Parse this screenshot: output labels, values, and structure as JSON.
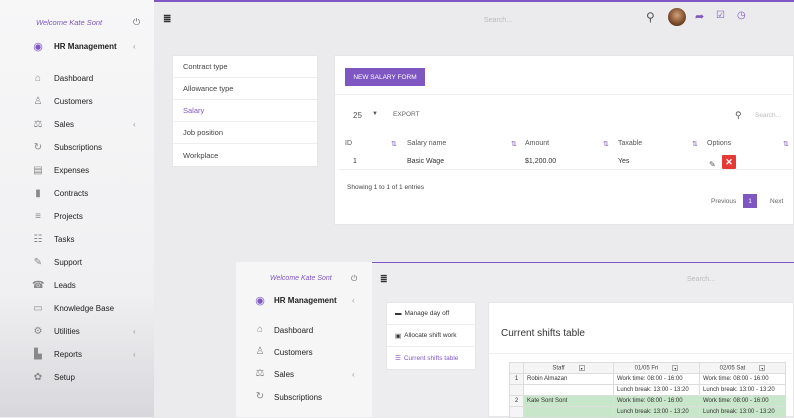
{
  "sidebar": {
    "welcome": "Welcome Kate Sont",
    "items": [
      {
        "label": "HR Management",
        "icon": "circle-user-icon",
        "caret": "‹"
      },
      {
        "label": "Dashboard",
        "icon": "home-icon",
        "caret": ""
      },
      {
        "label": "Customers",
        "icon": "user-icon",
        "caret": ""
      },
      {
        "label": "Sales",
        "icon": "balance-scale-icon",
        "caret": "‹"
      },
      {
        "label": "Subscriptions",
        "icon": "refresh-icon",
        "caret": ""
      },
      {
        "label": "Expenses",
        "icon": "file-text-icon",
        "caret": ""
      },
      {
        "label": "Contracts",
        "icon": "file-icon",
        "caret": ""
      },
      {
        "label": "Projects",
        "icon": "bars-icon",
        "caret": ""
      },
      {
        "label": "Tasks",
        "icon": "tasks-icon",
        "caret": ""
      },
      {
        "label": "Support",
        "icon": "ticket-icon",
        "caret": ""
      },
      {
        "label": "Leads",
        "icon": "tty-icon",
        "caret": ""
      },
      {
        "label": "Knowledge Base",
        "icon": "folder-open-icon",
        "caret": ""
      },
      {
        "label": "Utilities",
        "icon": "cogs-icon",
        "caret": "‹"
      },
      {
        "label": "Reports",
        "icon": "area-chart-icon",
        "caret": "‹"
      },
      {
        "label": "Setup",
        "icon": "gear-icon",
        "caret": ""
      }
    ]
  },
  "topbar": {
    "search_placeholder": "Search..."
  },
  "settings_menu": {
    "items": [
      "Contract type",
      "Allowance type",
      "Salary",
      "Job position",
      "Workplace"
    ],
    "active": "Salary"
  },
  "salary_panel": {
    "new_button": "NEW SALARY FORM",
    "page_size": "25",
    "export_label": "EXPORT",
    "search_placeholder": "Search...",
    "columns": [
      "ID",
      "Salary name",
      "Amount",
      "Taxable",
      "Options"
    ],
    "rows": [
      {
        "id": "1",
        "name": "Basic Wage",
        "amount": "$1,200.00",
        "taxable": "Yes"
      }
    ],
    "showing": "Showing 1 to 1 of 1 entries",
    "prev_label": "Previous",
    "page": "1",
    "next_label": "Next"
  },
  "shot2": {
    "welcome": "Welcome Kate Sont",
    "search_placeholder": "Search...",
    "nav": [
      {
        "label": "HR Management",
        "caret": "‹"
      },
      {
        "label": "Dashboard",
        "caret": ""
      },
      {
        "label": "Customers",
        "caret": ""
      },
      {
        "label": "Sales",
        "caret": "‹"
      },
      {
        "label": "Subscriptions",
        "caret": ""
      }
    ],
    "menu": [
      "Manage day off",
      "Allocate shift work",
      "Current shifts table"
    ],
    "panel_title": "Current shifts table",
    "grid": {
      "headers": [
        "Staff",
        "01/05 Fri",
        "02/05 Sat"
      ],
      "rows": [
        {
          "num": "1",
          "staff": "Robin Almazan",
          "c1": "Work time: 08:00 - 16:00",
          "c2": "Work time: 08:00 - 16:00"
        },
        {
          "num": "",
          "staff": "",
          "c1": "Lunch break: 13:00 - 13:20",
          "c2": "Lunch break: 13:00 - 13:20"
        },
        {
          "num": "2",
          "staff": "Kate Sont Sont",
          "c1": "Work time: 08:00 - 16:00",
          "c2": "Work time: 08:00 - 16:00"
        },
        {
          "num": "",
          "staff": "",
          "c1": "Lunch break: 13:00 - 13:20",
          "c2": "Lunch break: 13:00 - 13:20"
        }
      ]
    }
  },
  "colors": {
    "accent": "#7e57c2",
    "danger": "#e53935",
    "highlight": "#c8e6c9"
  }
}
